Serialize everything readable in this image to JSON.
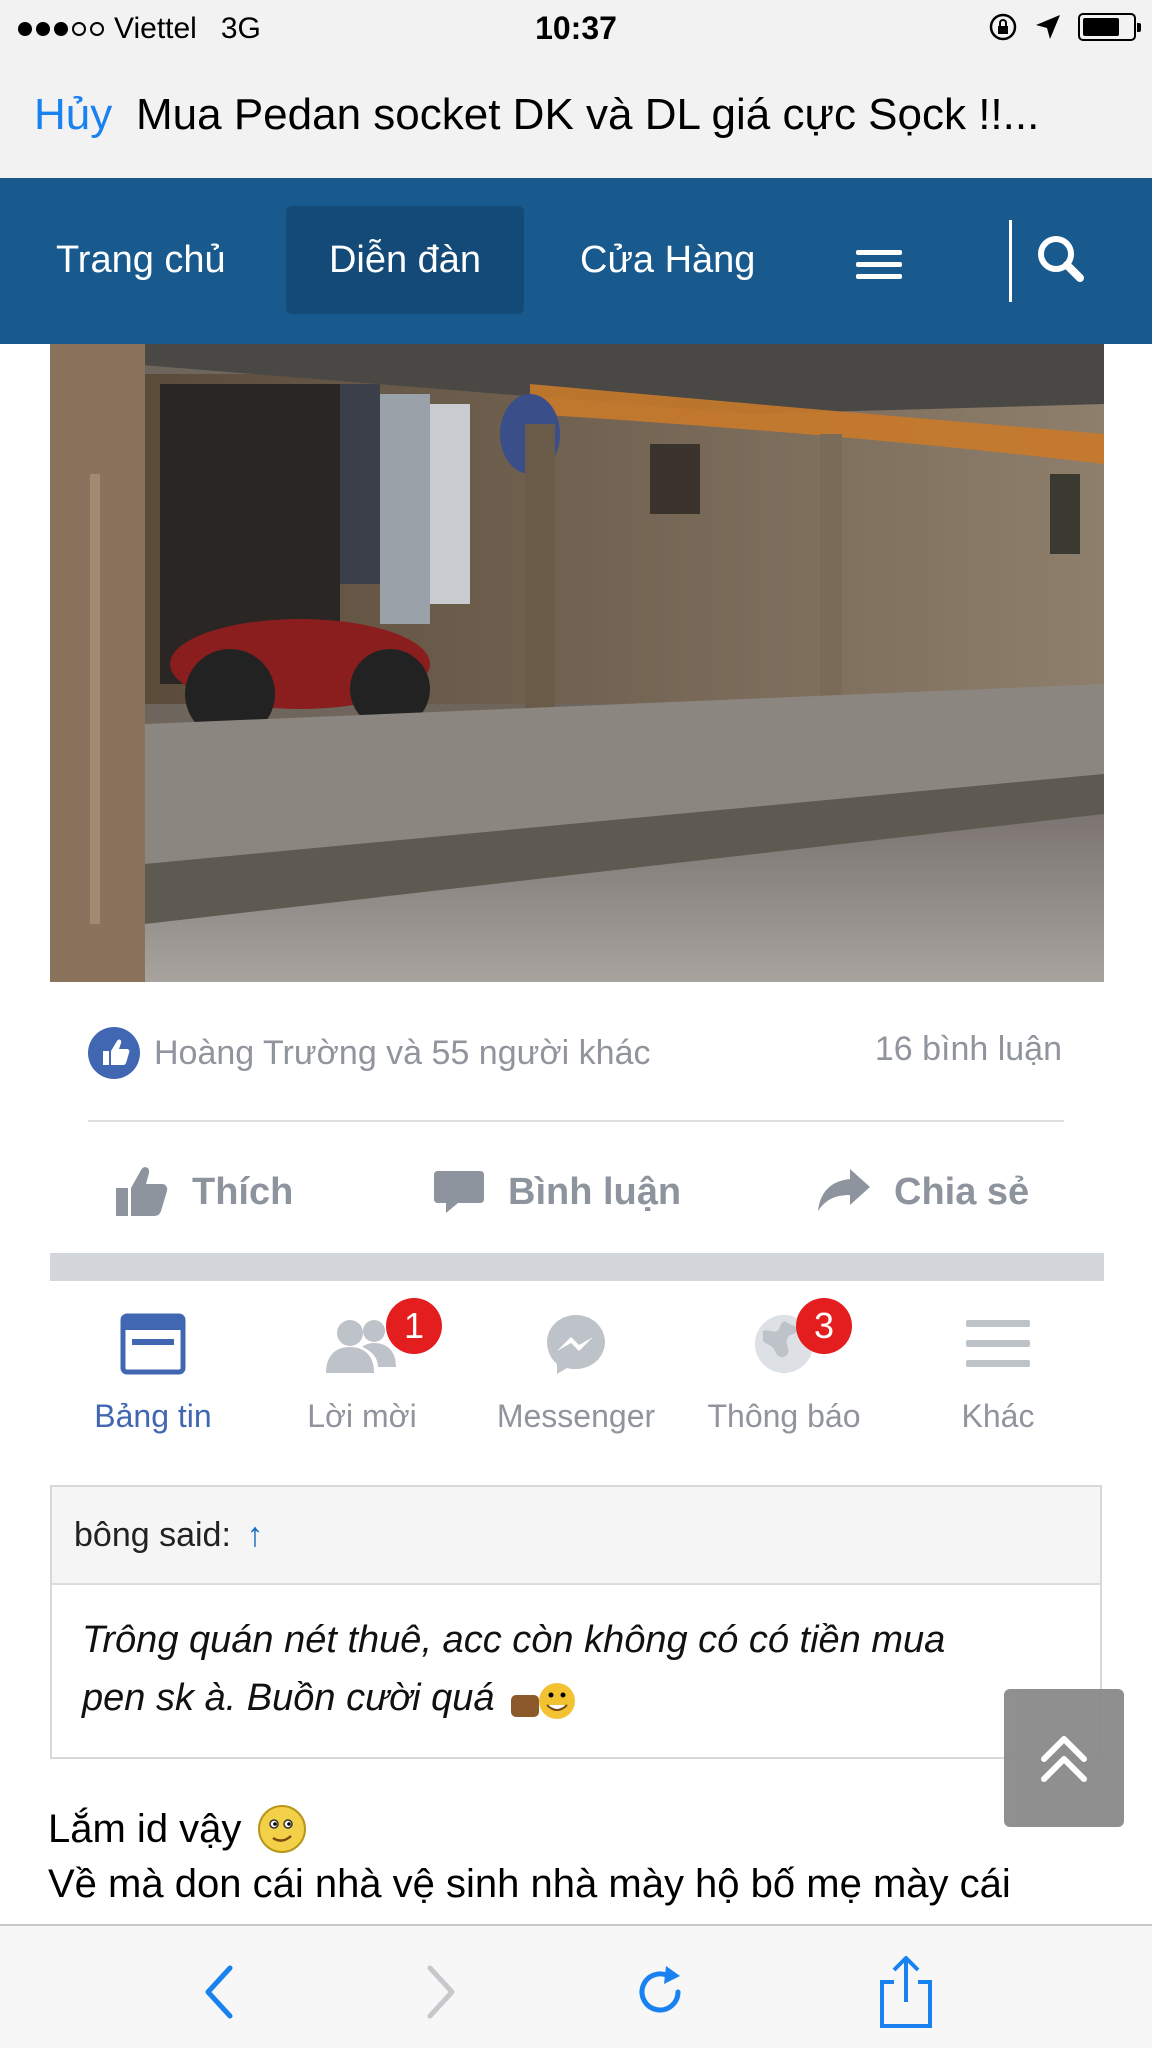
{
  "status": {
    "carrier": "Viettel",
    "network": "3G",
    "time": "10:37",
    "battery_level": 0.75
  },
  "browser": {
    "cancel_label": "Hủy",
    "page_title": "Mua Pedan socket DK và DL giá cực Sọck !!..."
  },
  "site_nav": {
    "items": [
      {
        "label": "Trang chủ"
      },
      {
        "label": "Diễn đàn"
      },
      {
        "label": "Cửa Hàng"
      }
    ],
    "active_index": 1
  },
  "post": {
    "likes_text": "Hoàng Trường và 55 người khác",
    "comments_text": "16 bình luận",
    "actions": {
      "like": "Thích",
      "comment": "Bình luận",
      "share": "Chia sẻ"
    }
  },
  "fb_nav": {
    "tabs": [
      {
        "label": "Bảng tin",
        "active": true
      },
      {
        "label": "Lời mời",
        "badge": "1"
      },
      {
        "label": "Messenger"
      },
      {
        "label": "Thông báo",
        "badge": "3"
      },
      {
        "label": "Khác"
      }
    ]
  },
  "quote": {
    "author_label": "bông said:",
    "arrow": "↑",
    "line1": "Trông quán nét thuê, acc còn không có có tiền mua",
    "line2": "pen sk à. Buồn cười quá"
  },
  "reply": {
    "line1": "Lắm id vậy",
    "line2": "Về mà don cái nhà vệ sinh nhà mày hộ bố mẹ mày cái"
  },
  "colors": {
    "nav_bg": "#185a8e",
    "link_blue": "#1a82f0",
    "fb_blue": "#4267b2",
    "badge_red": "#e41e1e"
  }
}
